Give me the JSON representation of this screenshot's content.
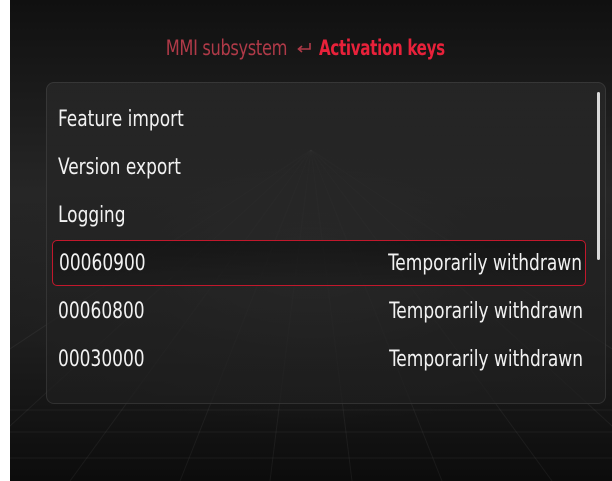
{
  "header": {
    "parent": "MMI subsystem",
    "current": "Activation keys",
    "separator_icon": "return-arrow-icon"
  },
  "menu": {
    "items": [
      {
        "label": "Feature import",
        "status": ""
      },
      {
        "label": "Version export",
        "status": ""
      },
      {
        "label": "Logging",
        "status": ""
      },
      {
        "label": "00060900",
        "status": "Temporarily withdrawn"
      },
      {
        "label": "00060800",
        "status": "Temporarily withdrawn"
      },
      {
        "label": "00030000",
        "status": "Temporarily withdrawn"
      }
    ],
    "selected_index": 3
  },
  "colors": {
    "accent": "#e8213a",
    "accent_dim": "#b03a48",
    "text": "#f2f2f2",
    "background": "#1e1e1e"
  }
}
